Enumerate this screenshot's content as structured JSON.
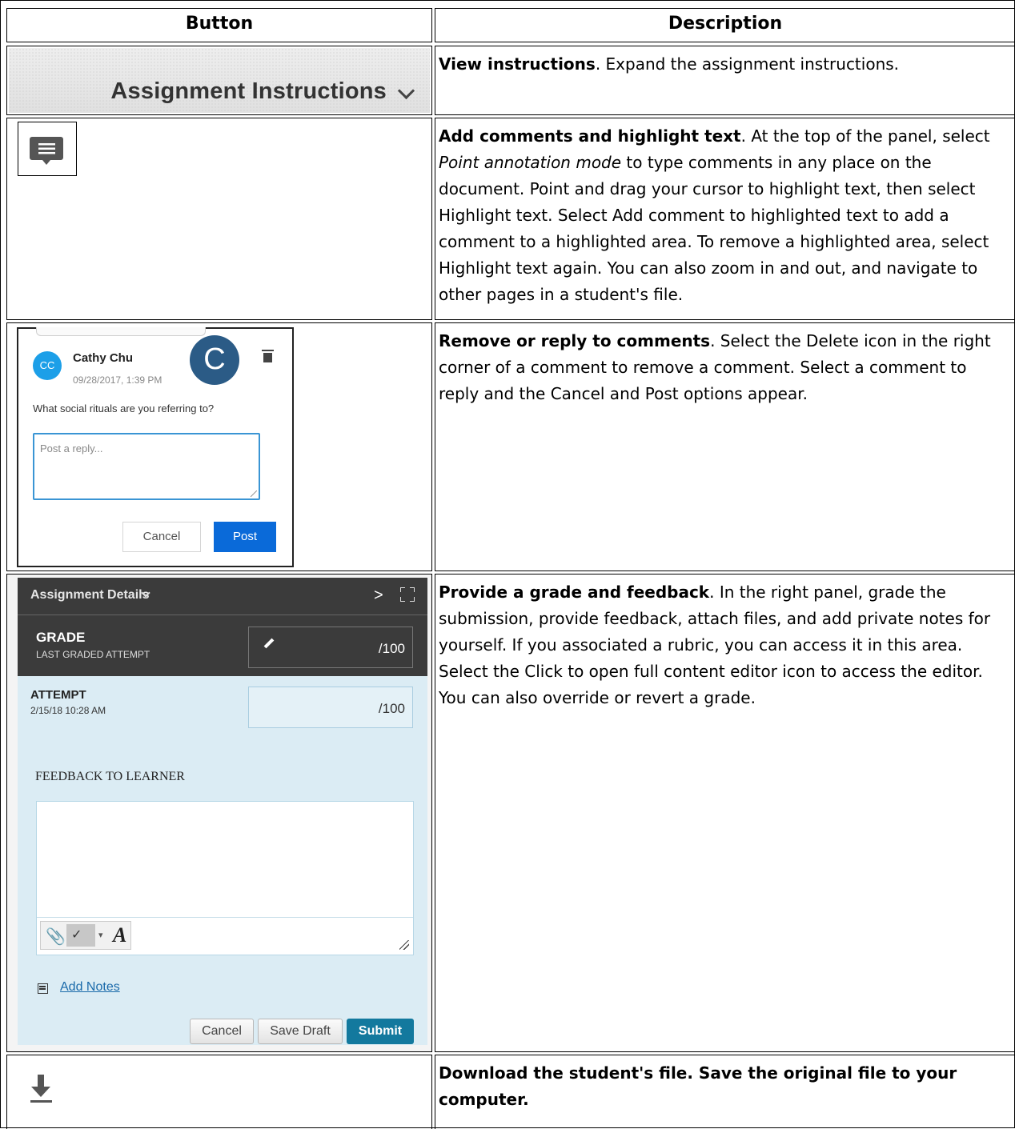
{
  "header": {
    "col_button": "Button",
    "col_description": "Description"
  },
  "row_instructions": {
    "button_label": "Assignment Instructions",
    "desc_bold": "View instructions",
    "desc_rest": ". Expand the assignment instructions."
  },
  "row_comments": {
    "icon": "comment-icon",
    "desc_bold": "Add comments and highlight text",
    "desc_1": ". At the top of the panel, select ",
    "desc_italic": "Point annotation mode",
    "desc_2": " to type comments in any place on the document. Point and drag your cursor to highlight text, then select Highlight text. Select Add comment to highlighted text to add a comment to a highlighted area. To remove a highlighted area, select Highlight text again. You can also zoom in and out, and navigate to other pages in a student's file."
  },
  "row_remove": {
    "card": {
      "avatar_initials": "CC",
      "name": "Cathy Chu",
      "date": "09/28/2017, 1:39 PM",
      "large_avatar_letter": "C",
      "question": "What social rituals are you referring to?",
      "reply_placeholder": "Post a reply...",
      "cancel": "Cancel",
      "post": "Post"
    },
    "desc_bold": "Remove or reply to comments",
    "desc_rest": ". Select the Delete icon in the right corner of a comment to remove a comment. Select a comment to reply and the Cancel and Post options appear."
  },
  "row_grade": {
    "panel": {
      "header_title": "Assignment Details",
      "grade_title": "GRADE",
      "grade_sub": "LAST GRADED ATTEMPT",
      "grade_max": "/100",
      "attempt_title": "ATTEMPT",
      "attempt_date": "2/15/18 10:28 AM",
      "attempt_max": "/100",
      "feedback_label": "FEEDBACK TO LEARNER",
      "add_notes": "Add Notes",
      "cancel": "Cancel",
      "save_draft": "Save Draft",
      "submit": "Submit"
    },
    "desc_bold": "Provide a grade and feedback",
    "desc_rest": ". In the right panel, grade the submission, provide feedback, attach files, and add private notes for yourself. If you associated a rubric, you can access it in this area. Select the Click to open full content editor icon to access the editor. You can also override or revert a grade."
  },
  "row_download": {
    "icon": "download-icon",
    "desc_bold": "Download the student's file. Save the original file to your computer."
  }
}
